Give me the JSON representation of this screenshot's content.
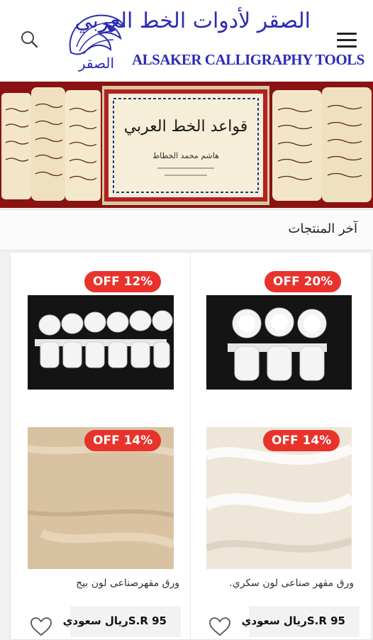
{
  "header": {
    "logo_arabic": "الصقر لأدوات الخط العربي",
    "logo_english": "ALSAKER CALLIGRAPHY TOOLS",
    "logo_emblem_text": "الصقر",
    "brand_color": "#2b2cb4"
  },
  "banner": {
    "book_title": "قواعد الخط العربي",
    "book_author": "هاشم محمد الخطاط"
  },
  "section": {
    "title": "آخر المنتجات"
  },
  "products": [
    {
      "badge": "OFF 20%",
      "image": "three-ink-pots-tray"
    },
    {
      "badge": "OFF 12%",
      "image": "six-ink-pots-tray"
    },
    {
      "badge": "OFF 14%",
      "name": "ورق مقهر صناعى لون سكري.",
      "price": "S.R 95ريال سعودي",
      "image": "sugar-color-paper"
    },
    {
      "badge": "OFF 14%",
      "name": "ورق مقهرصناعى لون بيج",
      "price": "S.R 95ريال سعودي",
      "image": "beige-paper"
    }
  ],
  "colors": {
    "badge": "#e8332c",
    "background": "#f1f1f1"
  },
  "icons": [
    "search-icon",
    "hamburger-menu-icon",
    "heart-icon"
  ]
}
